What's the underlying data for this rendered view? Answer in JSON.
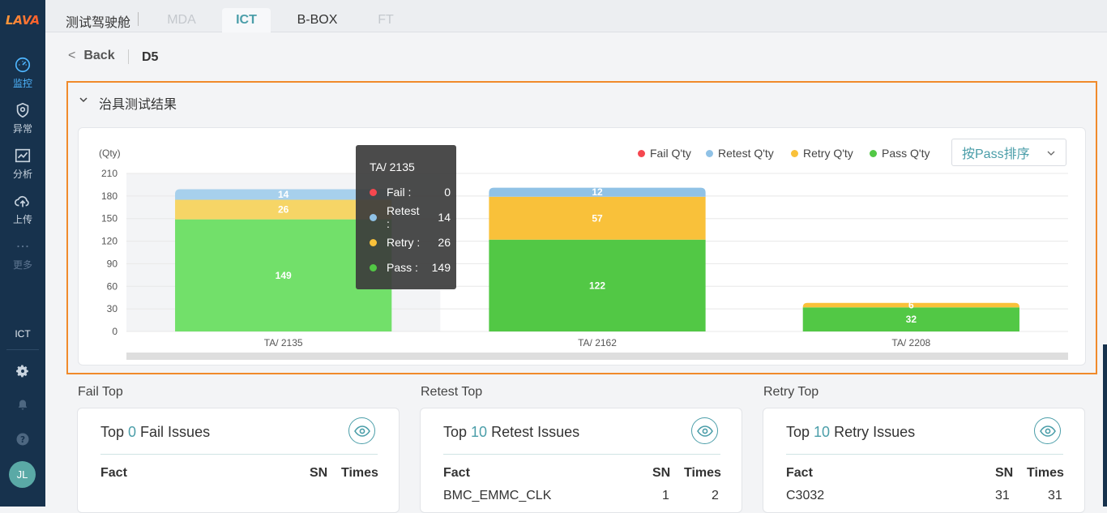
{
  "app": {
    "logo_text": "LAVA",
    "title": "测试驾驶舱"
  },
  "tabs": [
    {
      "label": "MDA",
      "state": "disabled"
    },
    {
      "label": "ICT",
      "state": "active"
    },
    {
      "label": "B-BOX",
      "state": "normal"
    },
    {
      "label": "FT",
      "state": "disabled"
    }
  ],
  "sidebar": {
    "items": [
      {
        "label": "监控",
        "icon": "dashboard-icon",
        "active": true
      },
      {
        "label": "异常",
        "icon": "shield-alert-icon",
        "active": false
      },
      {
        "label": "分析",
        "icon": "line-chart-icon",
        "active": false
      },
      {
        "label": "上传",
        "icon": "cloud-upload-icon",
        "active": false
      },
      {
        "label": "更多",
        "icon": "more-dots-icon",
        "active": false
      }
    ],
    "current_module": "ICT",
    "bottom_icons": [
      "gear-icon",
      "bell-icon",
      "help-icon"
    ],
    "avatar_initials": "JL"
  },
  "breadcrumb": {
    "back_label": "Back",
    "current": "D5"
  },
  "panel": {
    "title": "治具测试结果"
  },
  "sort_select": {
    "value": "按Pass排序"
  },
  "colors": {
    "fail": "#f5474f",
    "retest": "#90c2e6",
    "retry": "#f9c13a",
    "pass": "#52c845",
    "accent": "#4b9ea9"
  },
  "chart_data": {
    "type": "bar",
    "stacked": true,
    "ylabel": "(Qty)",
    "ylim": [
      0,
      210
    ],
    "yticks": [
      0,
      30,
      60,
      90,
      120,
      150,
      180,
      210
    ],
    "categories": [
      "TA/ 2135",
      "TA/ 2162",
      "TA/ 2208"
    ],
    "series": [
      {
        "name": "Fail Q'ty",
        "color": "#f5474f",
        "values": [
          0,
          0,
          0
        ]
      },
      {
        "name": "Retest Q'ty",
        "color": "#90c2e6",
        "values": [
          14,
          12,
          0
        ]
      },
      {
        "name": "Retry Q'ty",
        "color": "#f9c13a",
        "values": [
          26,
          57,
          6
        ]
      },
      {
        "name": "Pass Q'ty",
        "color": "#52c845",
        "values": [
          149,
          122,
          32
        ]
      }
    ],
    "legend_position": "top-right",
    "grid": true,
    "highlighted_category": 0
  },
  "tooltip": {
    "title": "TA/ 2135",
    "rows": [
      {
        "label": "Fail :",
        "value": "0",
        "color": "#f5474f"
      },
      {
        "label": "Retest :",
        "value": "14",
        "color": "#90c2e6"
      },
      {
        "label": "Retry :",
        "value": "26",
        "color": "#f9c13a"
      },
      {
        "label": "Pass :",
        "value": "149",
        "color": "#52c845"
      }
    ]
  },
  "issues": [
    {
      "section": "Fail Top",
      "prefix": "Top ",
      "count": "0",
      "suffix": " Fail Issues",
      "headers": [
        "Fact",
        "SN",
        "Times"
      ],
      "row": null
    },
    {
      "section": "Retest Top",
      "prefix": "Top ",
      "count": "10",
      "suffix": " Retest Issues",
      "headers": [
        "Fact",
        "SN",
        "Times"
      ],
      "row": [
        "BMC_EMMC_CLK",
        "1",
        "2"
      ]
    },
    {
      "section": "Retry Top",
      "prefix": "Top ",
      "count": "10",
      "suffix": " Retry Issues",
      "headers": [
        "Fact",
        "SN",
        "Times"
      ],
      "row": [
        "C3032",
        "31",
        "31"
      ]
    }
  ]
}
